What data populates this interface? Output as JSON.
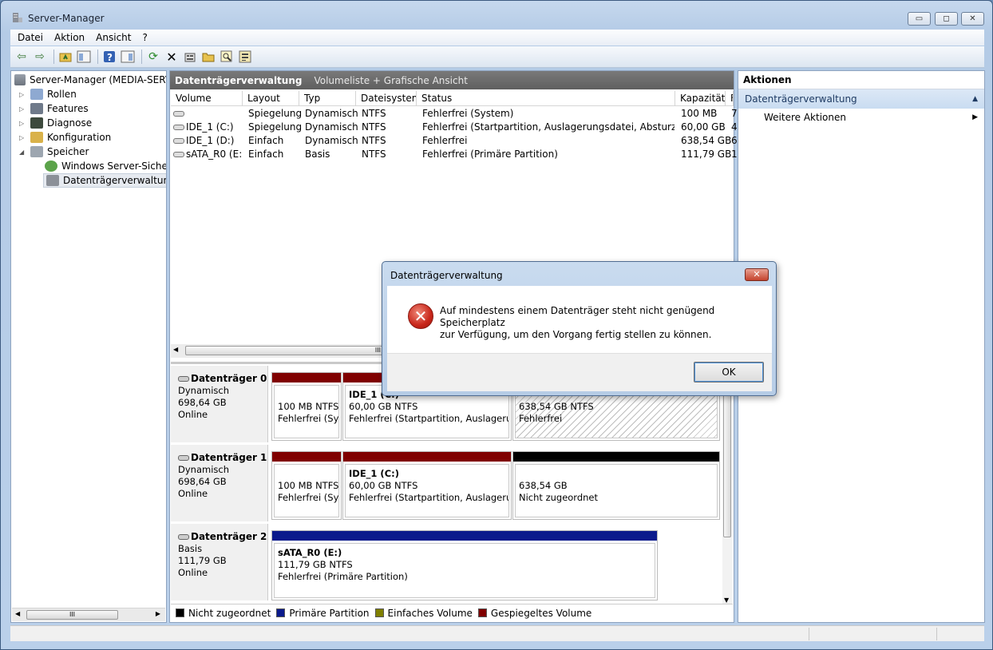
{
  "window": {
    "title": "Server-Manager",
    "minimize_label": "▭",
    "maximize_label": "◻",
    "close_label": "✕"
  },
  "menu": [
    "Datei",
    "Aktion",
    "Ansicht",
    "?"
  ],
  "tree": {
    "root": "Server-Manager (MEDIA-SERVEF",
    "items": [
      "Rollen",
      "Features",
      "Diagnose",
      "Konfiguration",
      "Speicher"
    ],
    "children": [
      "Windows Server-Sicherun",
      "Datenträgerverwaltung"
    ],
    "scroll_label": "III"
  },
  "center": {
    "title": "Datenträgerverwaltung",
    "subtitle": "Volumeliste + Grafische Ansicht",
    "columns": [
      "Volume",
      "Layout",
      "Typ",
      "Dateisystem",
      "Status",
      "Kapazität",
      "F"
    ],
    "rows": [
      [
        "",
        "Spiegelung",
        "Dynamisch",
        "NTFS",
        "Fehlerfrei (System)",
        "100 MB",
        "7"
      ],
      [
        "IDE_1 (C:)",
        "Spiegelung",
        "Dynamisch",
        "NTFS",
        "Fehlerfrei (Startpartition, Auslagerungsdatei, Absturzabbild)",
        "60,00 GB",
        "4"
      ],
      [
        "IDE_1 (D:)",
        "Einfach",
        "Dynamisch",
        "NTFS",
        "Fehlerfrei",
        "638,54 GB",
        "6"
      ],
      [
        "sATA_R0 (E:)",
        "Einfach",
        "Basis",
        "NTFS",
        "Fehlerfrei (Primäre Partition)",
        "111,79 GB",
        "1"
      ]
    ],
    "hscroll_label": "III"
  },
  "disks": [
    {
      "name": "Datenträger 0",
      "type": "Dynamisch",
      "size": "698,64 GB",
      "state": "Online",
      "parts": [
        {
          "title": "",
          "line1": "100 MB NTFS",
          "line2": "Fehlerfrei (Sys"
        },
        {
          "title": "IDE_1  (C:)",
          "line1": "60,00 GB NTFS",
          "line2": "Fehlerfrei (Startpartition, Auslagerung"
        },
        {
          "title": "",
          "line1": "638,54 GB NTFS",
          "line2": "Fehlerfrei"
        }
      ]
    },
    {
      "name": "Datenträger 1",
      "type": "Dynamisch",
      "size": "698,64 GB",
      "state": "Online",
      "parts": [
        {
          "title": "",
          "line1": "100 MB NTFS",
          "line2": "Fehlerfrei (Sys"
        },
        {
          "title": "IDE_1  (C:)",
          "line1": "60,00 GB NTFS",
          "line2": "Fehlerfrei (Startpartition, Auslagerung"
        },
        {
          "title": "",
          "line1": "638,54 GB",
          "line2": "Nicht zugeordnet"
        }
      ]
    },
    {
      "name": "Datenträger 2",
      "type": "Basis",
      "size": "111,79 GB",
      "state": "Online",
      "parts": [
        {
          "title": "sATA_R0  (E:)",
          "line1": "111,79 GB NTFS",
          "line2": "Fehlerfrei (Primäre Partition)"
        }
      ]
    }
  ],
  "legend": [
    {
      "label": "Nicht zugeordnet",
      "color": "#000000"
    },
    {
      "label": "Primäre Partition",
      "color": "#0b1a8c"
    },
    {
      "label": "Einfaches Volume",
      "color": "#808000"
    },
    {
      "label": "Gespiegeltes Volume",
      "color": "#800000"
    }
  ],
  "actions": {
    "title": "Aktionen",
    "section": "Datenträgerverwaltung",
    "item": "Weitere Aktionen"
  },
  "dialog": {
    "title": "Datenträgerverwaltung",
    "message_line1": "Auf mindestens einem Datenträger steht nicht genügend Speicherplatz",
    "message_line2": "zur Verfügung, um den Vorgang fertig stellen zu können.",
    "ok": "OK",
    "close": "✕"
  },
  "colors": {
    "mirrored": "#800000",
    "primary": "#0b1a8c",
    "unallocated": "#000000"
  }
}
